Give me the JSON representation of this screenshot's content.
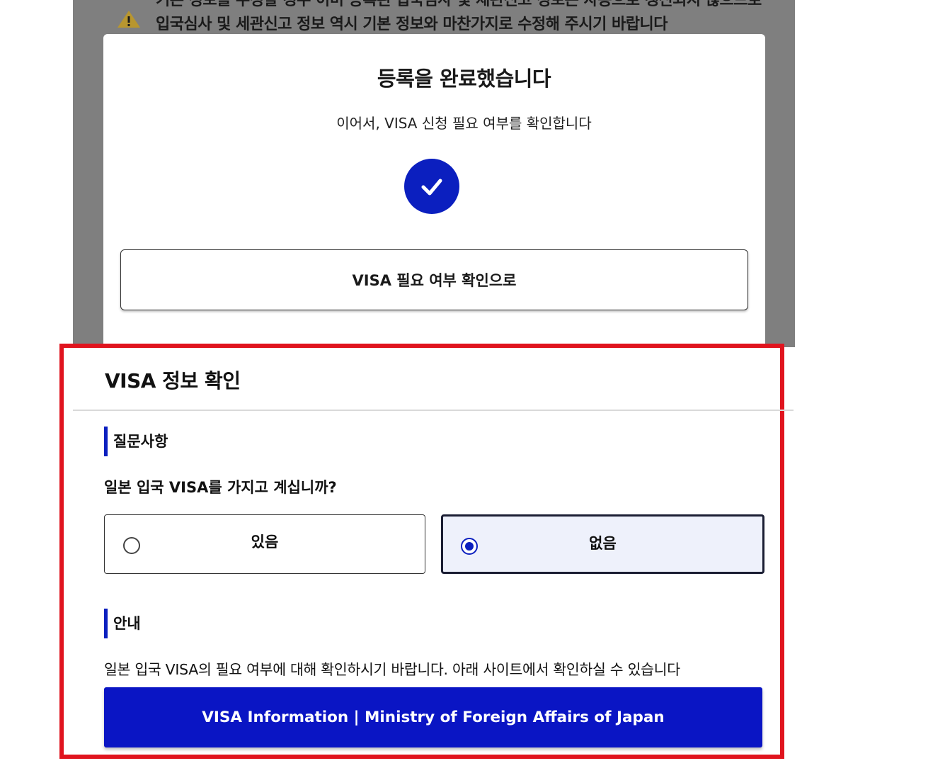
{
  "warning": {
    "text": "기본 정보를 수정할 경우 이미 등록된 입국심사 및 세관신고 정보는 자동으로 갱신되지 않으므로 입국심사 및 세관신고 정보 역시 기본 정보와 마찬가지로 수정해 주시기 바랍니다",
    "icon": "warning-icon"
  },
  "modal": {
    "title": "등록을 완료했습니다",
    "subtitle": "이어서, VISA 신청 필요 여부를 확인합니다",
    "check_icon": "check-circle-icon",
    "button_label": "VISA 필요 여부 확인으로"
  },
  "visa": {
    "title": "VISA 정보 확인",
    "question_section": "질문사항",
    "question": "일본 입국 VISA를 가지고 계십니까?",
    "options": [
      {
        "label": "있음",
        "selected": false
      },
      {
        "label": "없음",
        "selected": true
      }
    ],
    "guide_section": "안내",
    "guide_text": "일본 입국 VISA의 필요 여부에 대해 확인하시기 바랍니다. 아래 사이트에서 확인하실 수 있습니다",
    "link_label": "VISA Information | Ministry of Foreign Affairs of Japan"
  },
  "colors": {
    "accent": "#0b1fbf",
    "highlight_border": "#e0141e",
    "overlay": "#7f7f7f"
  }
}
